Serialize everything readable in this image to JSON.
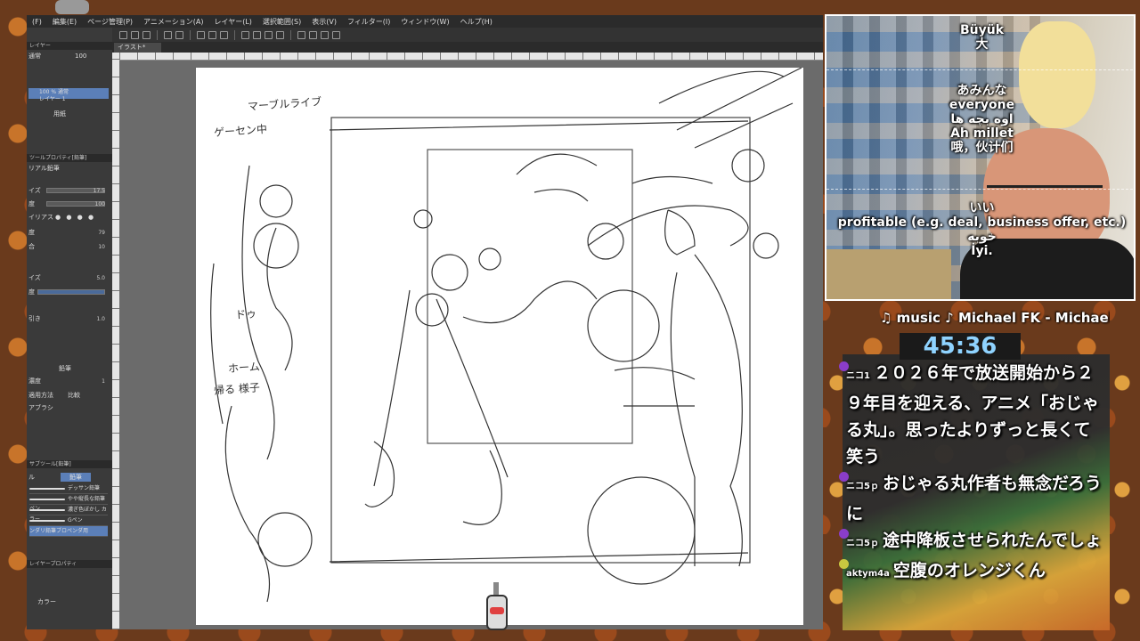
{
  "app": {
    "menu": [
      "(F)",
      "編集(E)",
      "ページ管理(P)",
      "アニメーション(A)",
      "レイヤー(L)",
      "選択範囲(S)",
      "表示(V)",
      "フィルター(I)",
      "ウィンドウ(W)",
      "ヘルプ(H)"
    ],
    "tab_label": "イラスト*",
    "left_panel": {
      "layer_header": "レイヤー",
      "blend_mode": "通常",
      "opacity_value": "100",
      "layer_name_1": "100 % 通常",
      "layer_name_1b": "レイヤー 1",
      "layer_name_2": "用紙",
      "tool_header": "ツールプロパティ[鉛筆]",
      "tool_name": "リアル鉛筆",
      "size_label": "イズ",
      "size_value": "17.5",
      "density_label": "度",
      "density_value": "100",
      "aa_label": "イリアス",
      "hardness_label": "度",
      "hardness_value": "79",
      "mix_label": "合",
      "mix_value": "10",
      "brush_size_label": "イズ",
      "brush_size_value": "5.0",
      "brush_label": "度",
      "paper_label": "引き",
      "paper_value": "1.0",
      "pencil_label": "鉛筆",
      "density2_label": "濃度",
      "density2_value": "1",
      "apply_label": "適用方法",
      "apply_value": "比較",
      "brush_shape_label": "アブラシ",
      "subtool_header": "サブツール[鉛筆]",
      "subtool_tab_pencil": "鉛筆",
      "subtool_tab_mil": "ル",
      "brushes": [
        "デッサン鉛筆",
        "やや縦長な鉛筆ペン",
        "濃ぎ色ぼかし カラー",
        "Gペン",
        "ンダリ鉛筆ブロペンダ用"
      ],
      "layer_prop_header": "レイヤープロパティ",
      "color_label": "カラー"
    },
    "sketch_texts": {
      "note_1": "マーブルライブ",
      "note_2": "ゲーセン中",
      "note_3": "ドゥ",
      "note_4": "ホーム",
      "note_5": "帰る 様子"
    }
  },
  "webcam": {
    "subtitles_top": [
      "Büyük",
      "大"
    ],
    "subtitles_mid": [
      "あみんな",
      "everyone",
      "اوه بچه ها",
      "Ah millet",
      "哦，伙计们"
    ],
    "subtitles_bottom": [
      "いい",
      "profitable (e.g. deal, business offer, etc.)",
      "خوبه",
      "İyi."
    ]
  },
  "overlay": {
    "music": "♫ music ♪ Michael FK - Michael FK",
    "timer": "45:36"
  },
  "chat": [
    {
      "user": "ニコ1",
      "text": "２０２６年で放送開始から２９年目を迎える、アニメ「おじゃる丸」。思ったよりずっと長くて笑う"
    },
    {
      "user": "ニコ5ｐ",
      "text": "おじゃる丸作者も無念だろうに"
    },
    {
      "user": "ニコ5ｐ",
      "text": "途中降板させられたんでしょ"
    },
    {
      "user": "aktym4a",
      "text": "空腹のオレンジくん"
    }
  ],
  "colors": {
    "timer": "#8fd3ff",
    "accent": "#5b7fb8"
  }
}
